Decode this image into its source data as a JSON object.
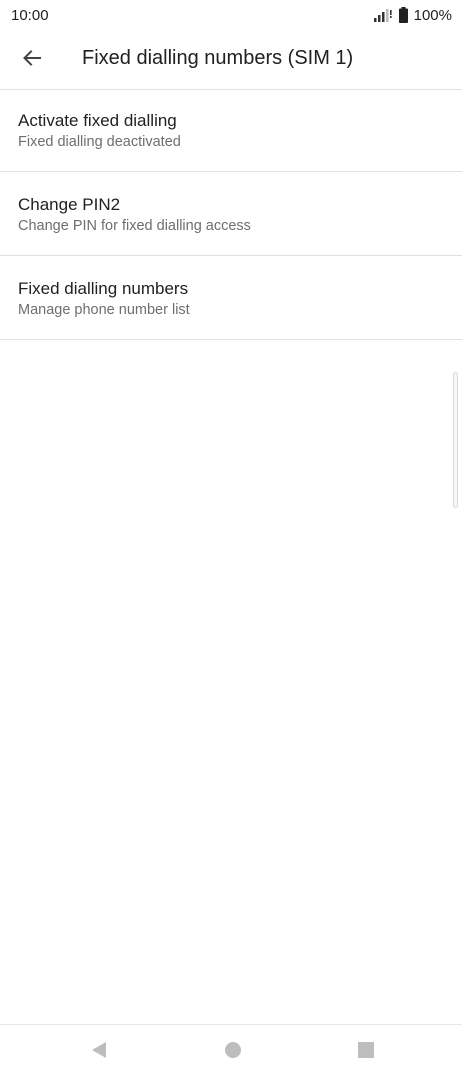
{
  "status_bar": {
    "time": "10:00",
    "battery_percent": "100%",
    "icons": [
      "signal-icon",
      "battery-icon"
    ]
  },
  "app_bar": {
    "back_icon": "arrow-left-icon",
    "title": "Fixed dialling numbers (SIM 1)"
  },
  "settings": {
    "items": [
      {
        "title": "Activate fixed dialling",
        "subtitle": "Fixed dialling deactivated"
      },
      {
        "title": "Change PIN2",
        "subtitle": "Change PIN for fixed dialling access"
      },
      {
        "title": "Fixed dialling numbers",
        "subtitle": "Manage phone number list"
      }
    ]
  },
  "nav_bar": {
    "icons": [
      "back-triangle-icon",
      "home-circle-icon",
      "recents-square-icon"
    ]
  },
  "colors": {
    "text_primary": "#212121",
    "text_secondary": "#6e6e6e",
    "divider": "#e0e0e0",
    "nav_icon": "#bdbdbd"
  }
}
